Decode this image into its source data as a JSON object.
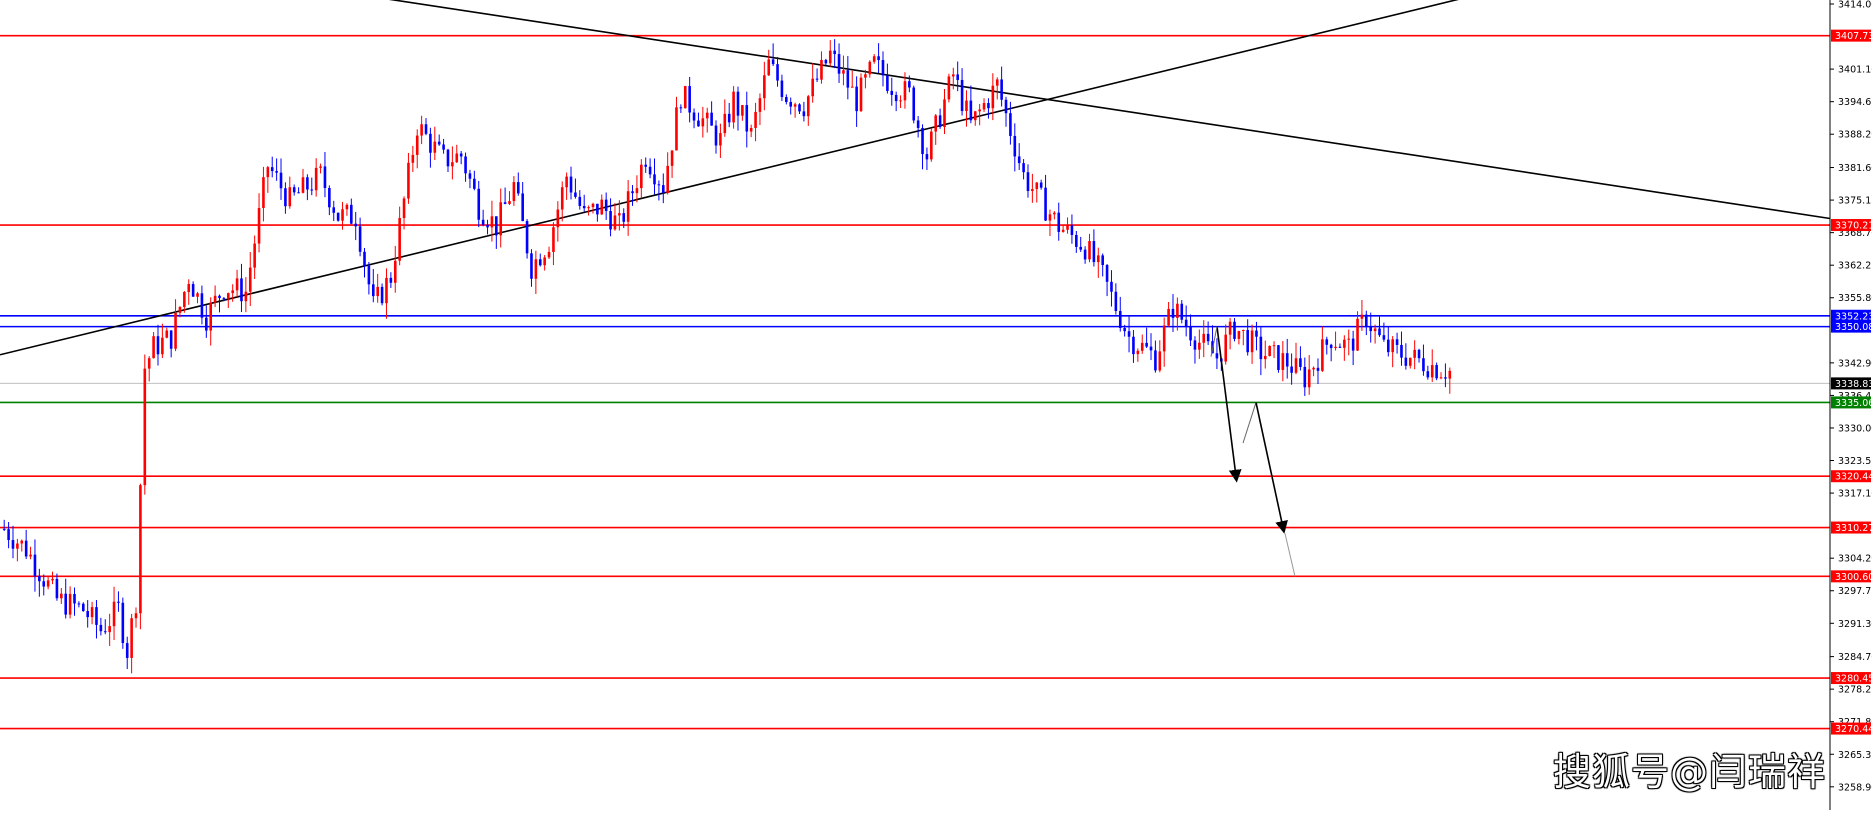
{
  "chart_data": {
    "type": "candlestick",
    "ylim": [
      3255.1,
      3414.0
    ],
    "grid": false,
    "colors": {
      "up_candle": "#ff0000",
      "down_candle": "#0000ff",
      "resistance_support_line": "#ff0000",
      "blue_zone_line": "#0000ff",
      "green_line": "#008000",
      "trend_line": "#000000",
      "current_price_line": "#c0c0c0",
      "price_tag_text": "#ffffff",
      "axis_text": "#000000"
    },
    "y_ticks": [
      {
        "value": 3414.0,
        "label": "3414.00"
      },
      {
        "value": 3401.1,
        "label": "3401.10"
      },
      {
        "value": 3394.65,
        "label": "3394.65"
      },
      {
        "value": 3388.2,
        "label": "3388.20"
      },
      {
        "value": 3381.6,
        "label": "3381.60"
      },
      {
        "value": 3375.15,
        "label": "3375.15"
      },
      {
        "value": 3368.7,
        "label": "3368.70"
      },
      {
        "value": 3362.25,
        "label": "3362.25"
      },
      {
        "value": 3355.8,
        "label": "3355.80"
      },
      {
        "value": 3342.9,
        "label": "3342.90"
      },
      {
        "value": 3336.45,
        "label": "3336.45"
      },
      {
        "value": 3330.0,
        "label": "3330.00"
      },
      {
        "value": 3323.55,
        "label": "3323.55"
      },
      {
        "value": 3317.1,
        "label": "3317.10"
      },
      {
        "value": 3304.2,
        "label": "3304.20"
      },
      {
        "value": 3297.75,
        "label": "3297.75"
      },
      {
        "value": 3291.3,
        "label": "3291.30"
      },
      {
        "value": 3284.7,
        "label": "3284.70"
      },
      {
        "value": 3278.25,
        "label": "3278.25"
      },
      {
        "value": 3271.8,
        "label": "3271.80"
      },
      {
        "value": 3265.35,
        "label": "3265.35"
      },
      {
        "value": 3258.9,
        "label": "3258.90"
      }
    ],
    "levels": [
      {
        "price": 3407.73,
        "label": "3407.73",
        "color": "#ff0000"
      },
      {
        "price": 3370.21,
        "label": "3370.21",
        "color": "#ff0000"
      },
      {
        "price": 3352.23,
        "label": "3352.23",
        "color": "#0000ff"
      },
      {
        "price": 3350.08,
        "label": "3350.08",
        "color": "#0000ff"
      },
      {
        "price": 3338.83,
        "label": "3338.83",
        "color": "#000000",
        "current": true
      },
      {
        "price": 3335.06,
        "label": "3335.06",
        "color": "#008000"
      },
      {
        "price": 3320.44,
        "label": "3320.44",
        "color": "#ff0000"
      },
      {
        "price": 3310.27,
        "label": "3310.27",
        "color": "#ff0000"
      },
      {
        "price": 3300.6,
        "label": "3300.60",
        "color": "#ff0000"
      },
      {
        "price": 3280.45,
        "label": "3280.45",
        "color": "#ff0000"
      },
      {
        "price": 3270.44,
        "label": "3270.44",
        "color": "#ff0000"
      }
    ],
    "candle_count": 330,
    "close_anchors": [
      [
        0,
        3310
      ],
      [
        5,
        3306
      ],
      [
        12,
        3296
      ],
      [
        18,
        3294
      ],
      [
        22,
        3290
      ],
      [
        26,
        3294
      ],
      [
        28,
        3286
      ],
      [
        30,
        3296
      ],
      [
        32,
        3342
      ],
      [
        34,
        3346
      ],
      [
        38,
        3348
      ],
      [
        42,
        3360
      ],
      [
        46,
        3352
      ],
      [
        50,
        3358
      ],
      [
        55,
        3357
      ],
      [
        60,
        3382
      ],
      [
        65,
        3375
      ],
      [
        72,
        3380
      ],
      [
        76,
        3372
      ],
      [
        80,
        3372
      ],
      [
        84,
        3354
      ],
      [
        88,
        3360
      ],
      [
        94,
        3390
      ],
      [
        100,
        3383
      ],
      [
        104,
        3384
      ],
      [
        108,
        3374
      ],
      [
        112,
        3370
      ],
      [
        116,
        3378
      ],
      [
        120,
        3362
      ],
      [
        124,
        3367
      ],
      [
        128,
        3380
      ],
      [
        132,
        3372
      ],
      [
        136,
        3374
      ],
      [
        140,
        3370
      ],
      [
        146,
        3384
      ],
      [
        150,
        3378
      ],
      [
        154,
        3396
      ],
      [
        158,
        3392
      ],
      [
        163,
        3387
      ],
      [
        166,
        3395
      ],
      [
        170,
        3388
      ],
      [
        174,
        3402
      ],
      [
        178,
        3396
      ],
      [
        182,
        3394
      ],
      [
        188,
        3404
      ],
      [
        194,
        3395
      ],
      [
        198,
        3402
      ],
      [
        202,
        3398
      ],
      [
        206,
        3396
      ],
      [
        210,
        3384
      ],
      [
        216,
        3400
      ],
      [
        220,
        3390
      ],
      [
        226,
        3398
      ],
      [
        232,
        3380
      ],
      [
        236,
        3375
      ],
      [
        240,
        3370
      ],
      [
        246,
        3366
      ],
      [
        250,
        3360
      ],
      [
        256,
        3348
      ],
      [
        262,
        3344
      ],
      [
        266,
        3354
      ],
      [
        272,
        3347
      ],
      [
        276,
        3344
      ],
      [
        280,
        3350
      ],
      [
        286,
        3345
      ],
      [
        292,
        3343
      ],
      [
        296,
        3340
      ],
      [
        302,
        3348
      ],
      [
        306,
        3346
      ],
      [
        310,
        3352
      ],
      [
        314,
        3346
      ],
      [
        320,
        3344
      ],
      [
        326,
        3342
      ],
      [
        330,
        3341
      ]
    ],
    "projection_arrow_1": [
      [
        1217,
        3350.08
      ],
      [
        1236,
        3320.44
      ]
    ],
    "projection_arrow_2": [
      [
        1243,
        3327.0
      ],
      [
        1256,
        3335.06
      ],
      [
        1283,
        3310.27
      ]
    ],
    "trendline_descending": [
      [
        0.13,
        3419.5
      ],
      [
        1.0,
        3371.5
      ]
    ],
    "trendline_ascending": [
      [
        0.0,
        3344.5
      ],
      [
        0.8,
        3415.2
      ]
    ]
  },
  "watermark": "搜狐号@闫瑞祥"
}
